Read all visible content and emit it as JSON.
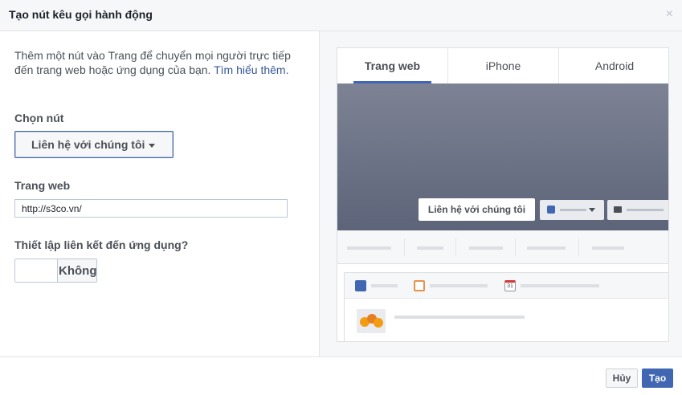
{
  "dialog": {
    "title": "Tạo nút kêu gọi hành động",
    "close_icon": "×"
  },
  "form": {
    "description": "Thêm một nút vào Trang để chuyển mọi người trực tiếp đến trang web hoặc ứng dụng của bạn.",
    "learn_more": "Tìm hiểu thêm.",
    "choose_button_label": "Chọn nút",
    "selected_button": "Liên hệ với chúng tôi",
    "website_label": "Trang web",
    "website_value": "http://s3co.vn/",
    "app_link_label": "Thiết lập liên kết đến ứng dụng?",
    "app_link_state": "Không"
  },
  "preview": {
    "tabs": [
      "Trang web",
      "iPhone",
      "Android"
    ],
    "active_tab": "Trang web",
    "cta_button": "Liên hệ với chúng tôi",
    "calendar_day": "31"
  },
  "footer": {
    "cancel_label": "Hủy",
    "create_label": "Tạo"
  },
  "colors": {
    "accent": "#4267b2",
    "link": "#365899",
    "header_bg": "#f6f7f9"
  }
}
